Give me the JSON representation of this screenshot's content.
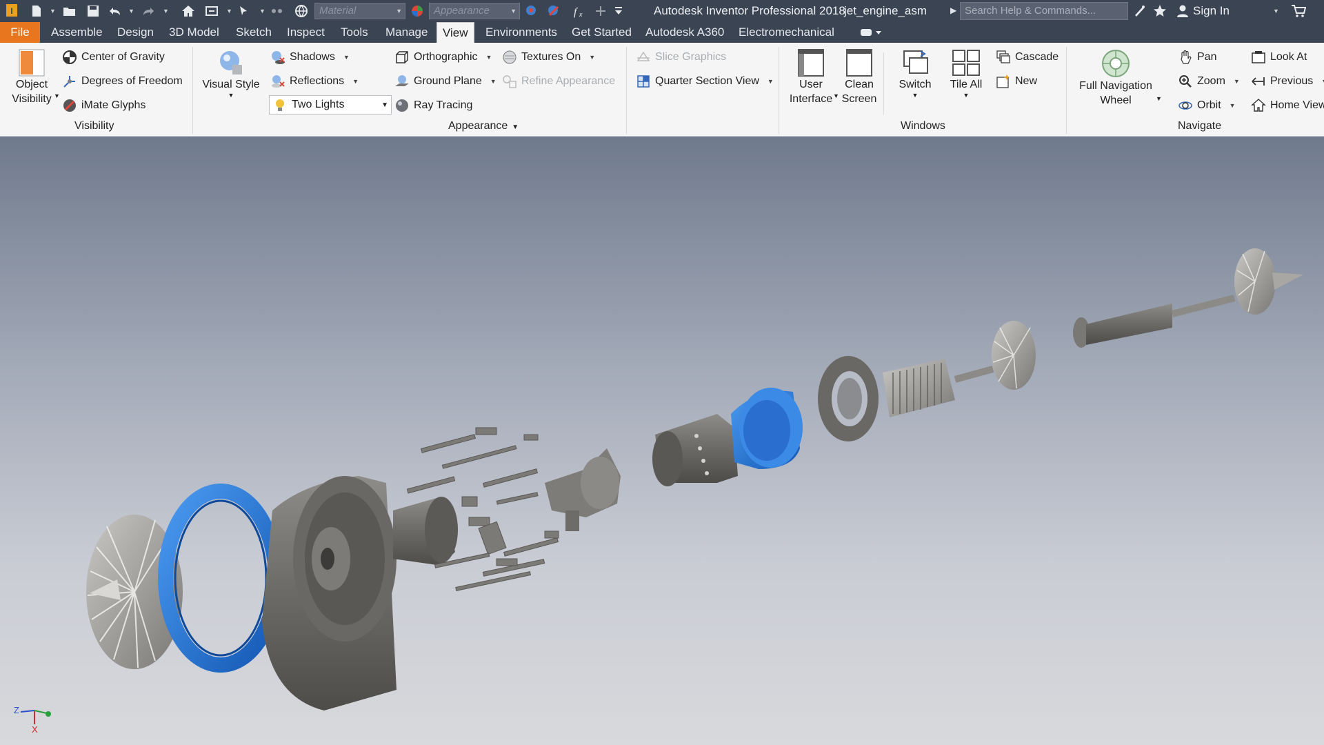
{
  "app": {
    "title": "Autodesk Inventor Professional 2018",
    "document": "jet_engine_asm",
    "search_placeholder": "Search Help & Commands...",
    "sign_in": "Sign In",
    "material_combo": "Material",
    "appearance_combo": "Appearance"
  },
  "tabs": [
    {
      "label": "File"
    },
    {
      "label": "Assemble"
    },
    {
      "label": "Design"
    },
    {
      "label": "3D Model"
    },
    {
      "label": "Sketch"
    },
    {
      "label": "Inspect"
    },
    {
      "label": "Tools"
    },
    {
      "label": "Manage"
    },
    {
      "label": "View"
    },
    {
      "label": "Environments"
    },
    {
      "label": "Get Started"
    },
    {
      "label": "Autodesk A360"
    },
    {
      "label": "Electromechanical"
    }
  ],
  "ribbon": {
    "visibility": {
      "label": "Visibility",
      "object_visibility": "Object\nVisibility",
      "center_of_gravity": "Center of Gravity",
      "degrees_of_freedom": "Degrees of Freedom",
      "imate_glyphs": "iMate Glyphs"
    },
    "appearance": {
      "label": "Appearance",
      "visual_style": "Visual Style",
      "shadows": "Shadows",
      "reflections": "Reflections",
      "lighting": "Two Lights",
      "orthographic": "Orthographic",
      "ground_plane": "Ground Plane",
      "ray_tracing": "Ray Tracing",
      "textures_on": "Textures On",
      "refine_appearance": "Refine Appearance"
    },
    "slice": {
      "slice_graphics": "Slice Graphics",
      "quarter_section_view": "Quarter Section View"
    },
    "windows": {
      "label": "Windows",
      "user_interface": "User\nInterface",
      "clean_screen": "Clean\nScreen",
      "switch": "Switch",
      "tile_all": "Tile All",
      "cascade": "Cascade",
      "new": "New"
    },
    "navigate": {
      "label": "Navigate",
      "full_navigation_wheel": "Full Navigation\nWheel",
      "pan": "Pan",
      "zoom": "Zoom",
      "orbit": "Orbit",
      "look_at": "Look At",
      "previous": "Previous",
      "home_view": "Home View"
    }
  },
  "viewport": {
    "triad_labels": {
      "z": "Z",
      "x": "X"
    }
  },
  "colors": {
    "titlebar": "#3b4452",
    "file_tab": "#e8761f",
    "ribbon": "#f5f5f5",
    "highlight_part": "#1e6fd0",
    "part_gray": "#6e6c69"
  }
}
